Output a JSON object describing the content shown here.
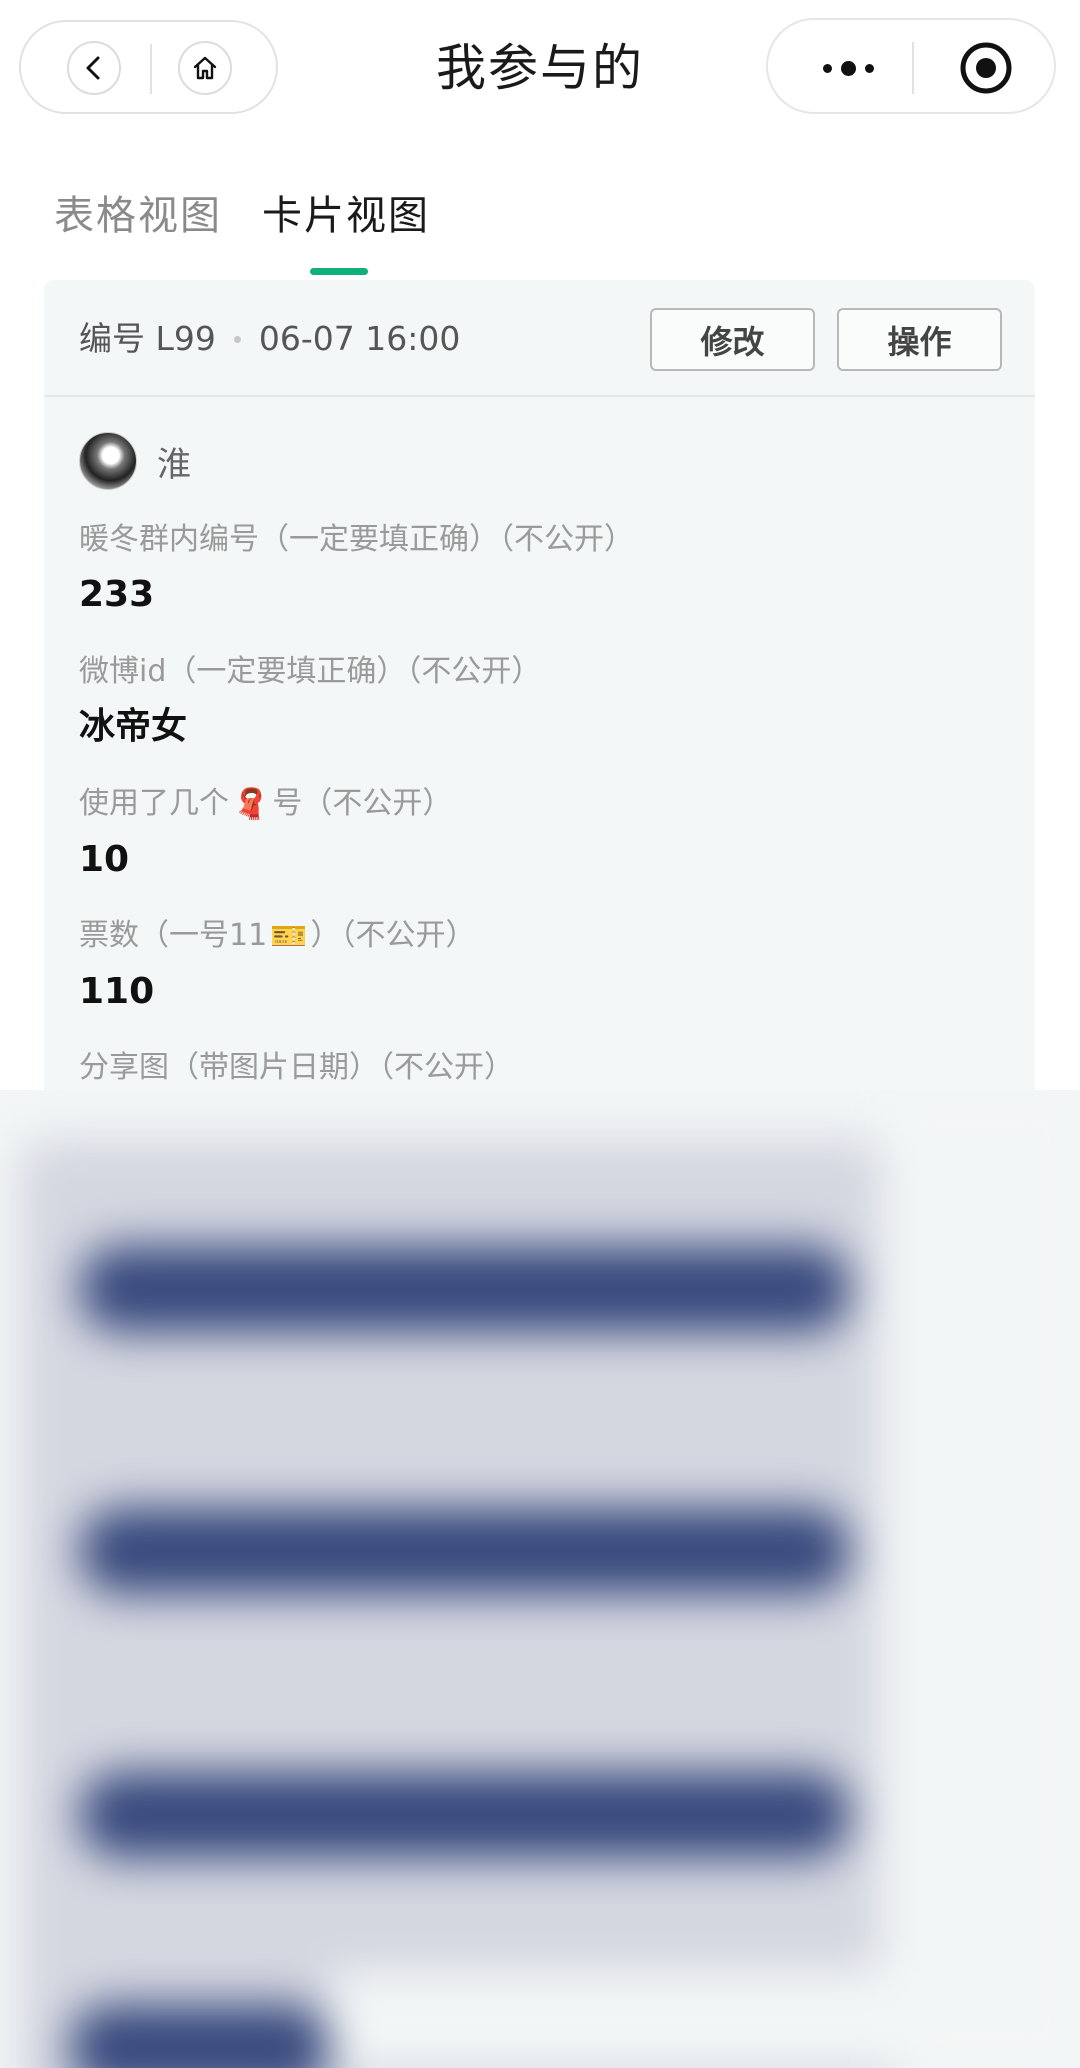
{
  "header": {
    "title": "我参与的",
    "back_icon": "chevron-left-icon",
    "home_icon": "home-icon",
    "more_icon": "more-dots-icon",
    "target_icon": "target-icon"
  },
  "tabs": [
    {
      "label": "表格视图",
      "active": false
    },
    {
      "label": "卡片视图",
      "active": true
    }
  ],
  "accent_color": "#10b07a",
  "record": {
    "number": "编号 L99",
    "datetime": "06-07 16:00",
    "edit_label": "修改",
    "ops_label": "操作",
    "submitter_name": "淮",
    "fields": [
      {
        "label": "暖冬群内编号（一定要填正确）（不公开）",
        "value": "233"
      },
      {
        "label": "微博id（一定要填正确）（不公开）",
        "value": "冰帝女"
      },
      {
        "label_before": "使用了几个",
        "label_emoji": "🧣",
        "label_after": "号（不公开）",
        "value": "10"
      },
      {
        "label_before": "票数（一号11",
        "label_emoji": "🎫",
        "label_after": "）（不公开）",
        "value": "110"
      },
      {
        "label": "分享图（带图片日期）（不公开）"
      }
    ]
  }
}
